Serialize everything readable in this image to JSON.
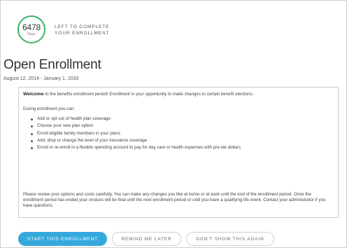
{
  "counter": {
    "number": "6478",
    "unit": "Days",
    "caption_line1": "LEFT TO COMPLETE",
    "caption_line2": "YOUR ENROLLMENT",
    "accent_color": "#3bb36a"
  },
  "header": {
    "title": "Open Enrollment",
    "date_range": "August 12, 2014 - January 1, 2033"
  },
  "content": {
    "welcome_bold": "Welcome",
    "welcome_text": " to the benefits enrollment period! Enrollment is your opportunity to make changes to certain benefit elections.",
    "during_text": "During enrollment you can:",
    "bullets": [
      "Add or opt out of health plan coverage",
      "Choose your new plan option",
      "Enroll eligible family members in your plans",
      "Add, drop or change the level of your insurance coverage",
      "Enroll or re-enroll in a flexible spending account to pay for day care or health expenses with pre-tax dollars"
    ],
    "review_text": "Please review your options and costs carefully. You can make any changes you like at home or at work until the end of the enrollment period. Once the enrollment period has ended your choices will be final until the next enrollment period or until you have a qualifying life event. Contact your administrator if you have questions."
  },
  "actions": {
    "start_label": "START THIS ENROLLMENT",
    "remind_label": "REMIND ME LATER",
    "dont_show_label": "DON'T SHOW THIS AGAIN",
    "primary_color": "#35a9dc"
  }
}
